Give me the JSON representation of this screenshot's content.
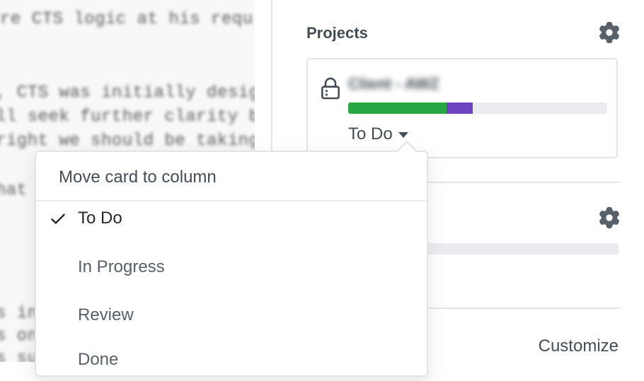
{
  "left_pane": {
    "lines": [
      "re CTS logic at his requ",
      ", CTS was initially desig",
      "ll seek further clarity b",
      "right we should be taking",
      "hat i",
      "s ing",
      "s one",
      "s  su"
    ]
  },
  "sidebar": {
    "projects_heading": "Projects",
    "project_card": {
      "title": "Client - AWZ",
      "progress": {
        "done": 0.38,
        "in_progress": 0.1,
        "colors": {
          "done": "#28a745",
          "in_progress": "#6f42c1",
          "track": "#eaecef"
        }
      },
      "column": "To Do"
    },
    "customize_label": "Customize"
  },
  "dropdown": {
    "header": "Move card to column",
    "items": [
      {
        "label": "To Do",
        "selected": true
      },
      {
        "label": "In Progress",
        "selected": false
      },
      {
        "label": "Review",
        "selected": false
      },
      {
        "label": "Done",
        "selected": false
      }
    ]
  },
  "icons": {
    "gear": "gear-icon",
    "lock": "lock-icon",
    "check": "check-icon",
    "caret": "caret-down-icon"
  }
}
